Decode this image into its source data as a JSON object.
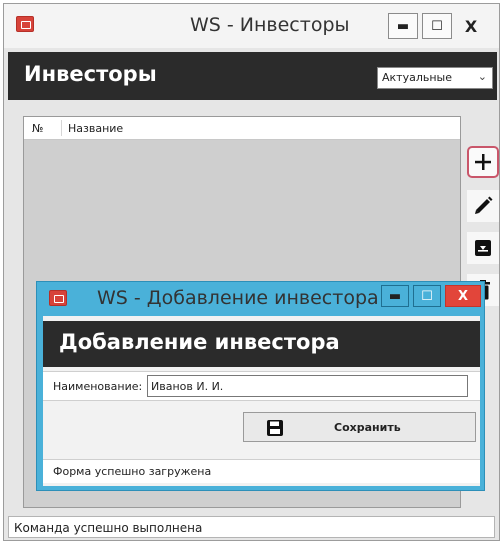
{
  "main_window": {
    "title": "WS - Инвесторы",
    "controls": {
      "minimize": "▬",
      "maximize": "☐",
      "close": "X"
    },
    "header_title": "Инвесторы",
    "filter": {
      "selected": "Актуальные"
    },
    "table": {
      "columns": [
        "№",
        "Название"
      ]
    },
    "side_buttons": [
      "plus-icon",
      "pencil-icon",
      "archive-icon",
      "trash-icon"
    ],
    "status": "Команда успешно выполнена"
  },
  "dialog": {
    "title": "WS - Добавление инвестора",
    "controls": {
      "minimize": "▬",
      "maximize": "☐",
      "close": "X"
    },
    "header_title": "Добавление инвестора",
    "field_label": "Наименование:",
    "field_value": "Иванов И. И.",
    "save_label": "Сохранить",
    "status": "Форма успешно загружена"
  },
  "colors": {
    "header_dark": "#2b2b2b",
    "dialog_frame": "#4ab1d9",
    "close_red": "#e2453a",
    "highlight": "#c9566a"
  }
}
